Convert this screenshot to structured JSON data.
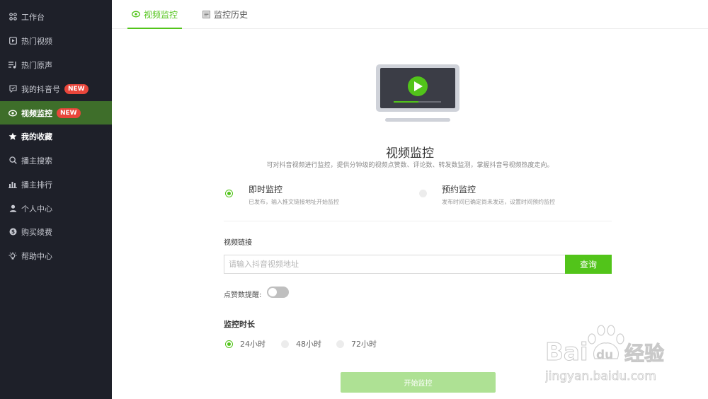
{
  "sidebar": {
    "items": [
      {
        "label": "工作台",
        "icon": "grid-icon"
      },
      {
        "label": "热门视频",
        "icon": "play-square-icon"
      },
      {
        "label": "热门原声",
        "icon": "music-list-icon"
      },
      {
        "label": "我的抖音号",
        "icon": "chat-icon",
        "badge": "NEW"
      },
      {
        "label": "视频监控",
        "icon": "eye-icon",
        "badge": "NEW"
      },
      {
        "label": "我的收藏",
        "icon": "star-icon"
      },
      {
        "label": "播主搜索",
        "icon": "search-icon"
      },
      {
        "label": "播主排行",
        "icon": "bar-chart-icon"
      },
      {
        "label": "个人中心",
        "icon": "user-icon"
      },
      {
        "label": "购买续费",
        "icon": "coin-icon"
      },
      {
        "label": "帮助中心",
        "icon": "bulb-icon"
      }
    ]
  },
  "tabs": [
    {
      "label": "视频监控",
      "icon": "eye-icon"
    },
    {
      "label": "监控历史",
      "icon": "document-icon"
    }
  ],
  "main": {
    "title": "视频监控",
    "subtitle": "可对抖音视频进行监控，提供分钟级的视频点赞数、评论数、转发数监测，掌握抖音号视频热度走向。",
    "modes": [
      {
        "title": "即时监控",
        "desc": "已发布，输入推文链接地址开始监控"
      },
      {
        "title": "预约监控",
        "desc": "发布时间已确定尚未发送，设置时间预约监控"
      }
    ],
    "link_label": "视频链接",
    "link_placeholder": "请输入抖音视频地址",
    "query_label": "查询",
    "like_reminder_label": "点赞数提醒:",
    "duration_label": "监控时长",
    "durations": [
      "24小时",
      "48小时",
      "72小时"
    ],
    "start_label": "开始监控"
  },
  "colors": {
    "accent": "#52c41a",
    "sidebar_bg": "#1e2029",
    "active_item": "#3e6e2a",
    "badge": "#e9463b"
  },
  "watermark": {
    "brand": "Bai",
    "brand2": "du",
    "cn": "经验",
    "url": "jingyan.baidu.com"
  }
}
